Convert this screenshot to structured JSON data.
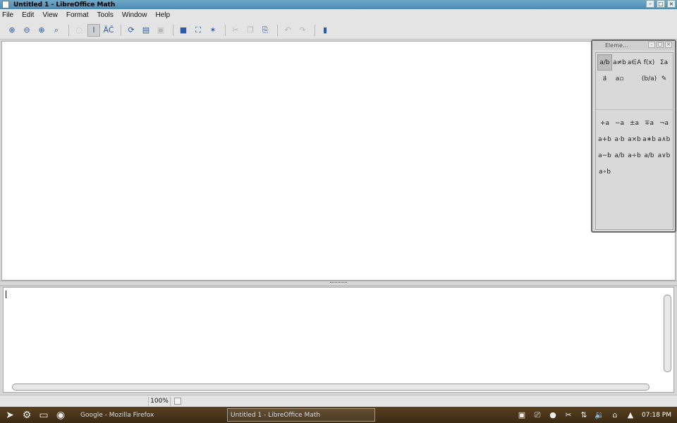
{
  "window": {
    "title": "Untitled 1 - LibreOffice Math",
    "buttons": [
      "–",
      "□",
      "×"
    ]
  },
  "menu": [
    "File",
    "Edit",
    "View",
    "Format",
    "Tools",
    "Window",
    "Help"
  ],
  "toolbar": {
    "buttons": [
      {
        "name": "zoom-in-icon",
        "glyph": "⊕"
      },
      {
        "name": "zoom-out-icon",
        "glyph": "⊖"
      },
      {
        "name": "zoom-100-icon",
        "glyph": "⊕"
      },
      {
        "name": "show-all-icon",
        "glyph": "⌕"
      },
      {
        "name": "update-icon",
        "glyph": "◌",
        "dim": true
      },
      {
        "name": "formula-cursor-icon",
        "glyph": "I",
        "sel": true
      },
      {
        "name": "symbols-icon",
        "glyph": "ÄČ"
      },
      {
        "name": "open-icon",
        "glyph": "⟳"
      },
      {
        "name": "print-icon",
        "glyph": "▤"
      },
      {
        "name": "save-icon",
        "glyph": "▣",
        "dim": true
      },
      {
        "name": "edit-mode-icon",
        "glyph": "■"
      },
      {
        "name": "export-pdf-icon",
        "glyph": "⛶"
      },
      {
        "name": "new-icon",
        "glyph": "✶"
      },
      {
        "name": "cut-icon",
        "glyph": "✂",
        "dim": true
      },
      {
        "name": "copy-icon",
        "glyph": "❐",
        "dim": true
      },
      {
        "name": "paste-icon",
        "glyph": "⎘"
      },
      {
        "name": "undo-icon",
        "glyph": "↶",
        "dim": true
      },
      {
        "name": "redo-icon",
        "glyph": "↷",
        "dim": true
      },
      {
        "name": "help-icon",
        "glyph": "▮"
      }
    ]
  },
  "elements": {
    "title": "Eleme...",
    "categories": [
      "a/b",
      "a≠b",
      "a∈A",
      "f(x)",
      "Σa",
      "a⃗",
      "a▫",
      "",
      "(b/a)",
      "✎"
    ],
    "symbols": [
      "+a",
      "−a",
      "±a",
      "∓a",
      "¬a",
      "a+b",
      "a·b",
      "a×b",
      "a∗b",
      "a∧b",
      "a−b",
      "a/b",
      "a÷b",
      "a/b",
      "a∨b",
      "a∘b"
    ]
  },
  "statusbar": {
    "zoom": "100%"
  },
  "taskbar": {
    "tasks": [
      {
        "label": "Google - Mozilla Firefox"
      },
      {
        "label": "Untitled 1 - LibreOffice Math"
      }
    ],
    "clock": "07:18 PM"
  }
}
